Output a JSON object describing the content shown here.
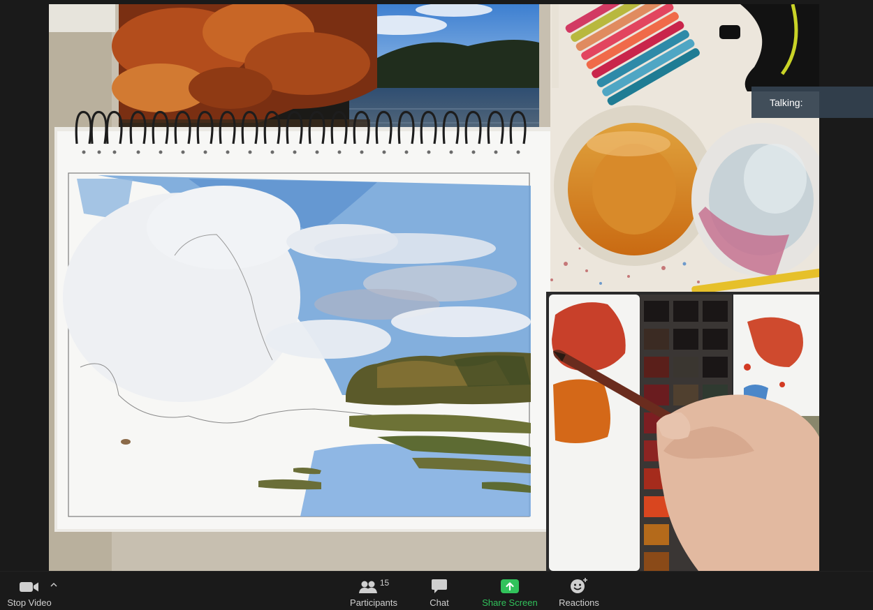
{
  "indicator": {
    "talking_label": "Talking:"
  },
  "toolbar": {
    "stop_video_label": "Stop Video",
    "participants_label": "Participants",
    "participants_count": "15",
    "chat_label": "Chat",
    "share_screen_label": "Share Screen",
    "reactions_label": "Reactions"
  },
  "colors": {
    "share_screen_accent": "#31c25b",
    "toolbar_background": "#1a1a1a",
    "talking_background": "#344250"
  }
}
